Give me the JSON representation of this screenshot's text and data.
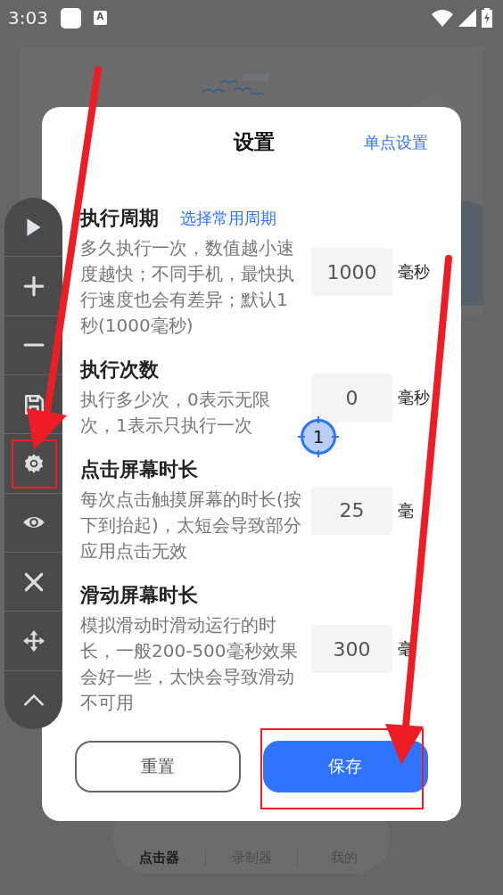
{
  "status_bar": {
    "time": "3:03",
    "input_badge": "A"
  },
  "bottom_nav": {
    "tabs": [
      {
        "label": "点击器",
        "selected": true
      },
      {
        "label": "录制器",
        "selected": false
      },
      {
        "label": "我的",
        "selected": false
      }
    ]
  },
  "dialog": {
    "title": "设置",
    "header_link": "单点设置",
    "settings": [
      {
        "title": "执行周期",
        "link": "选择常用周期",
        "description": "多久执行一次，数值越小速度越快；不同手机，最快执行速度也会有差异；默认1秒(1000毫秒)",
        "value": "1000",
        "unit": "毫秒"
      },
      {
        "title": "执行次数",
        "description": "执行多少次，0表示无限次，1表示只执行一次",
        "value": "0",
        "unit": "毫秒"
      },
      {
        "title": "点击屏幕时长",
        "description": "每次点击触摸屏幕的时长(按下到抬起)，太短会导致部分应用点击无效",
        "value": "25",
        "unit": "毫"
      },
      {
        "title": "滑动屏幕时长",
        "description": "模拟滑动时滑动运行的时长，一般200-500毫秒效果会好一些，太快会导致滑动不可用",
        "value": "300",
        "unit": "毫"
      }
    ],
    "buttons": [
      {
        "label": "重置",
        "kind": "secondary"
      },
      {
        "label": "保存",
        "kind": "primary"
      }
    ]
  },
  "target_marker": {
    "label": "1"
  }
}
